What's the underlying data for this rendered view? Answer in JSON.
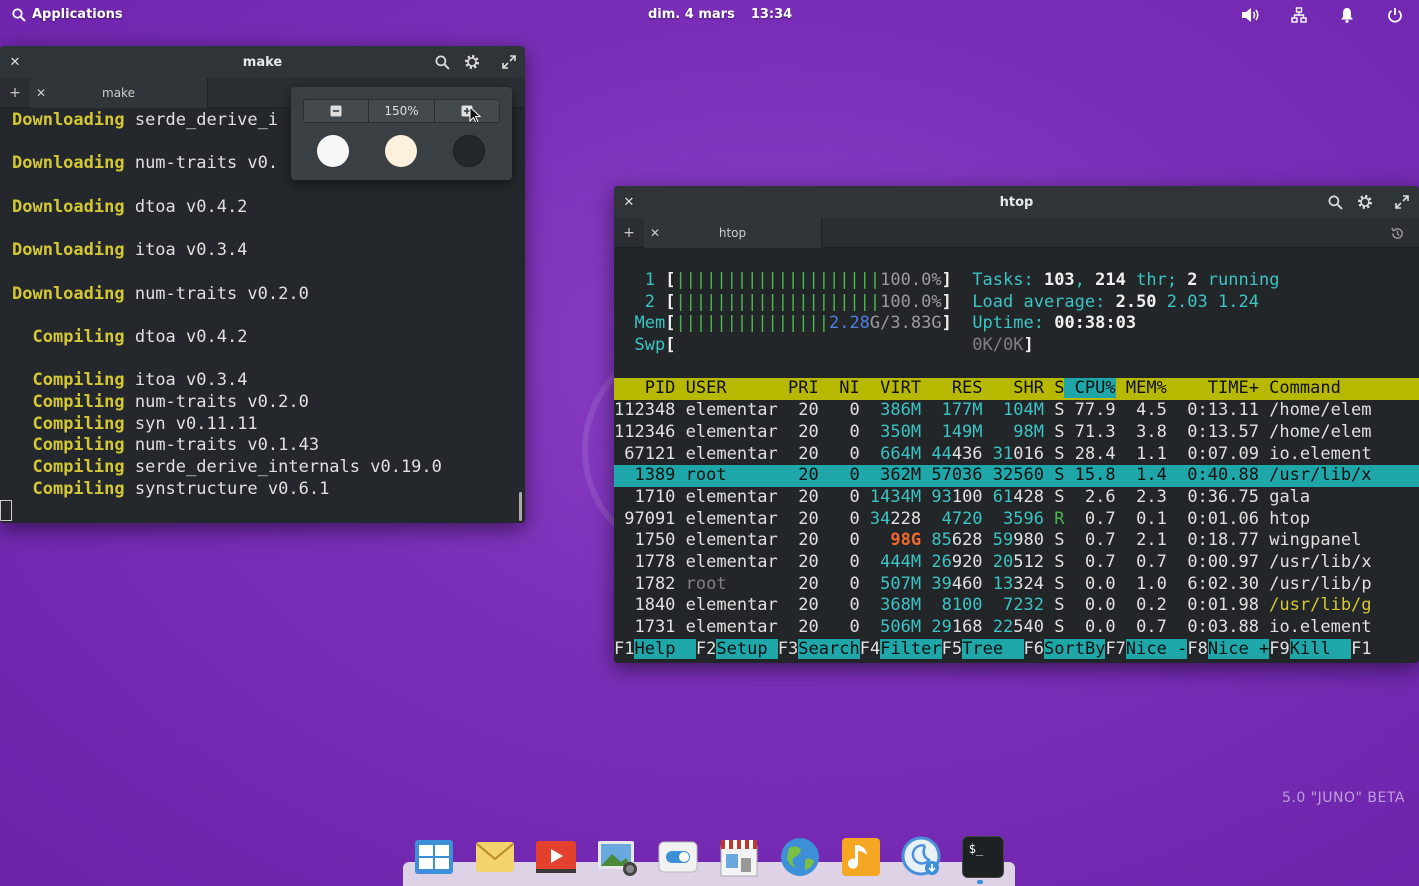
{
  "panel": {
    "applications": "Applications",
    "date": "dim. 4 mars",
    "time": "13:34",
    "icons": [
      "volume-icon",
      "network-icon",
      "notifications-icon",
      "power-icon"
    ]
  },
  "make_window": {
    "title": "make",
    "tab_label": "make",
    "lines": [
      {
        "kw": "Downloading",
        "rest": " serde_derive_i",
        "indent": ""
      },
      {
        "kw": "",
        "rest": "",
        "indent": ""
      },
      {
        "kw": "Downloading",
        "rest": " num-traits v0.",
        "indent": ""
      },
      {
        "kw": "",
        "rest": "",
        "indent": ""
      },
      {
        "kw": "Downloading",
        "rest": " dtoa v0.4.2",
        "indent": ""
      },
      {
        "kw": "",
        "rest": "",
        "indent": ""
      },
      {
        "kw": "Downloading",
        "rest": " itoa v0.3.4",
        "indent": ""
      },
      {
        "kw": "",
        "rest": "",
        "indent": ""
      },
      {
        "kw": "Downloading",
        "rest": " num-traits v0.2.0",
        "indent": ""
      },
      {
        "kw": "",
        "rest": "",
        "indent": ""
      },
      {
        "kw": "Compiling",
        "rest": " dtoa v0.4.2",
        "indent": "  "
      },
      {
        "kw": "",
        "rest": "",
        "indent": ""
      },
      {
        "kw": "Compiling",
        "rest": " itoa v0.3.4",
        "indent": "  "
      },
      {
        "kw": "Compiling",
        "rest": " num-traits v0.2.0",
        "indent": "  "
      },
      {
        "kw": "Compiling",
        "rest": " syn v0.11.11",
        "indent": "  "
      },
      {
        "kw": "Compiling",
        "rest": " num-traits v0.1.43",
        "indent": "  "
      },
      {
        "kw": "Compiling",
        "rest": " serde_derive_internals v0.19.0",
        "indent": "  "
      },
      {
        "kw": "Compiling",
        "rest": " synstructure v0.6.1",
        "indent": "  "
      }
    ]
  },
  "zoom_popover": {
    "zoom_level": "150%",
    "zoom_out_icon": "minus-icon",
    "zoom_in_icon": "plus-icon",
    "swatches": [
      "#f8f8f8",
      "#fdf0dc",
      "#24282c"
    ]
  },
  "htop_window": {
    "title": "htop",
    "tab_label": "htop",
    "cpu": [
      {
        "num": "1",
        "bars": "||||||||||||||||||||",
        "pct": "100.0%"
      },
      {
        "num": "2",
        "bars": "||||||||||||||||||||",
        "pct": "100.0%"
      }
    ],
    "mem": {
      "label": "Mem",
      "bars": "|||||||||||||||",
      "used": "2.28",
      "total": "G/3.83G"
    },
    "swp": {
      "label": "Swp",
      "value": "0K/0K"
    },
    "tasks": {
      "label": "Tasks: ",
      "count": "103",
      "thr_sep": ", ",
      "thr": "214",
      "thr_label": " thr; ",
      "running": "2",
      "running_label": " running"
    },
    "load": {
      "label": "Load average: ",
      "v1": "2.50",
      "v5": "2.03",
      "v15": "1.24"
    },
    "uptime": {
      "label": "Uptime: ",
      "value": "00:38:03"
    },
    "columns": [
      "PID",
      "USER",
      "PRI",
      "NI",
      "VIRT",
      "RES",
      "SHR",
      "S",
      "CPU%",
      "MEM%",
      "TIME+",
      "Command"
    ],
    "rows": [
      {
        "pid": "112348",
        "user": "elementar",
        "pri": "20",
        "ni": "0",
        "virt": "386M",
        "res": "177M",
        "shr": "104M",
        "s": "S",
        "cpu": "77.9",
        "mem": "4.5",
        "time": "0:13.11",
        "cmd": "/home/elem"
      },
      {
        "pid": "112346",
        "user": "elementar",
        "pri": "20",
        "ni": "0",
        "virt": "350M",
        "res": "149M",
        "shr": "98M",
        "s": "S",
        "cpu": "71.3",
        "mem": "3.8",
        "time": "0:13.57",
        "cmd": "/home/elem"
      },
      {
        "pid": "67121",
        "user": "elementar",
        "pri": "20",
        "ni": "0",
        "virt": "664M",
        "res": "44436",
        "shr": "31016",
        "s": "S",
        "cpu": "28.4",
        "mem": "1.1",
        "time": "0:07.09",
        "cmd": "io.element"
      },
      {
        "pid": "1389",
        "user": "root",
        "pri": "20",
        "ni": "0",
        "virt": "362M",
        "res": "57036",
        "shr": "32560",
        "s": "S",
        "cpu": "15.8",
        "mem": "1.4",
        "time": "0:40.88",
        "cmd": "/usr/lib/x"
      },
      {
        "pid": "1710",
        "user": "elementar",
        "pri": "20",
        "ni": "0",
        "virt": "1434M",
        "res": "93100",
        "shr": "61428",
        "s": "S",
        "cpu": "2.6",
        "mem": "2.3",
        "time": "0:36.75",
        "cmd": "gala"
      },
      {
        "pid": "97091",
        "user": "elementar",
        "pri": "20",
        "ni": "0",
        "virt": "34228",
        "res": "4720",
        "shr": "3596",
        "s": "R",
        "cpu": "0.7",
        "mem": "0.1",
        "time": "0:01.06",
        "cmd": "htop"
      },
      {
        "pid": "1750",
        "user": "elementar",
        "pri": "20",
        "ni": "0",
        "virt": "98G",
        "res": "85628",
        "shr": "59980",
        "s": "S",
        "cpu": "0.7",
        "mem": "2.1",
        "time": "0:18.77",
        "cmd": "wingpanel"
      },
      {
        "pid": "1778",
        "user": "elementar",
        "pri": "20",
        "ni": "0",
        "virt": "444M",
        "res": "26920",
        "shr": "20512",
        "s": "S",
        "cpu": "0.7",
        "mem": "0.7",
        "time": "0:00.97",
        "cmd": "/usr/lib/x"
      },
      {
        "pid": "1782",
        "user": "root",
        "pri": "20",
        "ni": "0",
        "virt": "507M",
        "res": "39460",
        "shr": "13324",
        "s": "S",
        "cpu": "0.0",
        "mem": "1.0",
        "time": "6:02.30",
        "cmd": "/usr/lib/p"
      },
      {
        "pid": "1840",
        "user": "elementar",
        "pri": "20",
        "ni": "0",
        "virt": "368M",
        "res": "8100",
        "shr": "7232",
        "s": "S",
        "cpu": "0.0",
        "mem": "0.2",
        "time": "0:01.98",
        "cmd": "/usr/lib/g"
      },
      {
        "pid": "1731",
        "user": "elementar",
        "pri": "20",
        "ni": "0",
        "virt": "506M",
        "res": "29168",
        "shr": "22540",
        "s": "S",
        "cpu": "0.0",
        "mem": "0.7",
        "time": "0:03.88",
        "cmd": "io.element"
      }
    ],
    "fkeys": [
      {
        "key": "F1",
        "label": "Help  "
      },
      {
        "key": "F2",
        "label": "Setup "
      },
      {
        "key": "F3",
        "label": "Search"
      },
      {
        "key": "F4",
        "label": "Filter"
      },
      {
        "key": "F5",
        "label": "Tree  "
      },
      {
        "key": "F6",
        "label": "SortBy"
      },
      {
        "key": "F7",
        "label": "Nice -"
      },
      {
        "key": "F8",
        "label": "Nice +"
      },
      {
        "key": "F9",
        "label": "Kill  "
      },
      {
        "key": "F1",
        "label": ""
      }
    ]
  },
  "version_label": "5.0 \"JUNO\" BETA",
  "dock": {
    "apps": [
      "multitasking-view-icon",
      "mail-icon",
      "videos-icon",
      "photos-icon",
      "settings-icon",
      "appcenter-icon",
      "web-browser-icon",
      "music-icon",
      "installer-icon",
      "terminal-icon"
    ],
    "terminal_glyph": "$_"
  },
  "colors": {
    "background": "#7a2eb8",
    "terminal_bg": "#24282c",
    "keyword_yellow": "#d4c832",
    "htop_header": "#b7b900",
    "htop_selected": "#1fa6a8"
  }
}
